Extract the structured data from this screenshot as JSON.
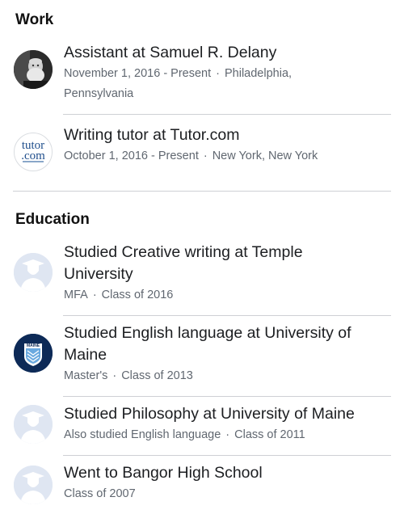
{
  "work": {
    "heading": "Work",
    "items": [
      {
        "title": "Assistant at Samuel R. Delany",
        "date": "November 1, 2016 - Present",
        "location_line1": "Philadelphia,",
        "location_line2": "Pennsylvania",
        "icon": "person-photo-icon"
      },
      {
        "title": "Writing tutor at Tutor.com",
        "date": "October 1, 2016 - Present",
        "location": "New York, New York",
        "icon": "tutor-com-logo-icon",
        "logo_text_top": "tutor",
        "logo_text_bottom": ".com"
      }
    ]
  },
  "education": {
    "heading": "Education",
    "items": [
      {
        "title_line1": "Studied Creative writing at Temple",
        "title_line2": "University",
        "degree": "MFA",
        "class": "Class of 2016",
        "icon": "graduate-placeholder-icon"
      },
      {
        "title_line1": "Studied English language at University of",
        "title_line2": "Maine",
        "degree": "Master's",
        "class": "Class of 2013",
        "icon": "university-of-maine-logo-icon",
        "logo_text": "MAINE"
      },
      {
        "title": "Studied Philosophy at University of Maine",
        "detail": "Also studied English language",
        "class": "Class of 2011",
        "icon": "graduate-placeholder-icon"
      },
      {
        "title": "Went to Bangor High School",
        "class": "Class of 2007",
        "icon": "graduate-placeholder-icon"
      }
    ]
  },
  "separator": "·",
  "colors": {
    "title_text": "#1c1e21",
    "meta_text": "#606770",
    "divider": "#ced0d4",
    "placeholder_bg": "#dfe6f2",
    "maine_navy": "#0d2a57"
  }
}
